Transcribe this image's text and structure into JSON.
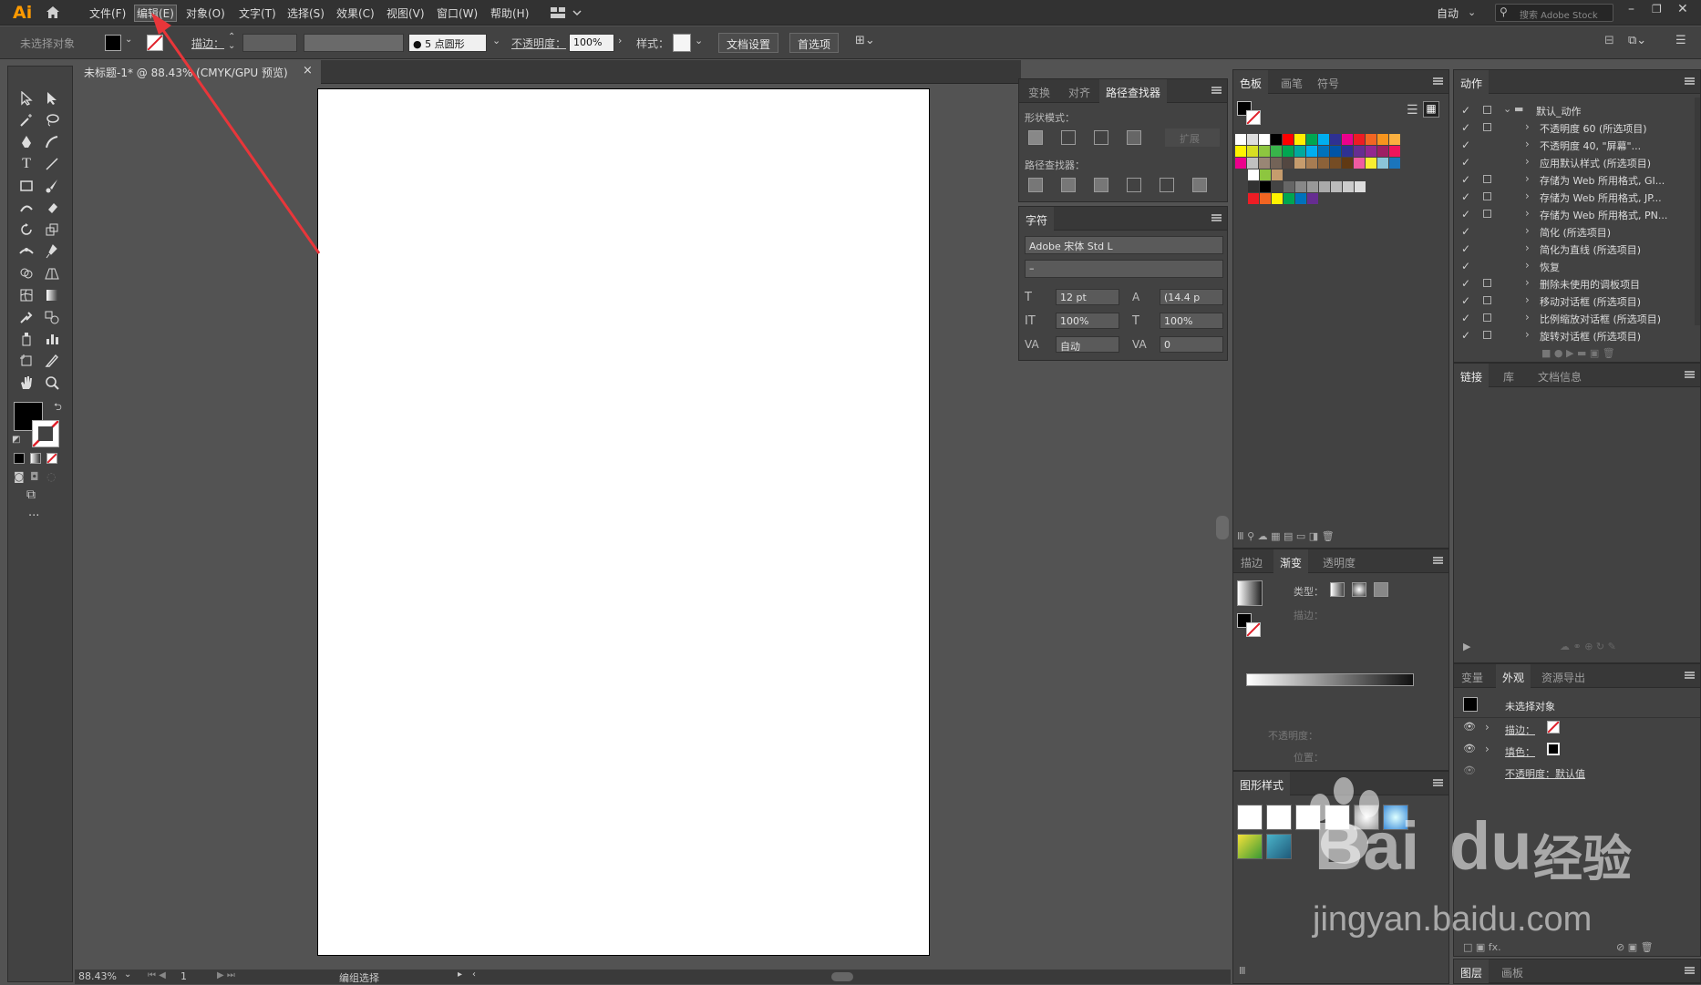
{
  "app": {
    "logo": "Ai"
  },
  "menu": [
    "文件(F)",
    "编辑(E)",
    "对象(O)",
    "文字(T)",
    "选择(S)",
    "效果(C)",
    "视图(V)",
    "窗口(W)",
    "帮助(H)"
  ],
  "window": {
    "workspace": "自动",
    "search_placeholder": "搜索 Adobe Stock"
  },
  "control": {
    "selection": "未选择对象",
    "stroke_label": "描边：",
    "brush": "5 点圆形",
    "opacity_label": "不透明度：",
    "opacity_value": "100%",
    "style_label": "样式：",
    "doc_setup": "文档设置",
    "prefs": "首选项"
  },
  "doc_tab": {
    "title": "未标题-1* @ 88.43% (CMYK/GPU 预览)",
    "close": "×"
  },
  "status": {
    "zoom": "88.43%",
    "page": "1",
    "tool": "编组选择"
  },
  "pathfinder": {
    "tabs": [
      "变换",
      "对齐",
      "路径查找器"
    ],
    "shape_modes": "形状模式：",
    "expand": "扩展",
    "pathfinders": "路径查找器："
  },
  "character": {
    "title": "字符",
    "font": "Adobe 宋体 Std L",
    "style": "–",
    "size": "12 pt",
    "leading": "(14.4 p",
    "v_scale": "100%",
    "h_scale": "100%",
    "kerning": "自动",
    "tracking": "0"
  },
  "swatches": {
    "tabs": [
      "色板",
      "画笔",
      "符号"
    ]
  },
  "gradient": {
    "tabs": [
      "描边",
      "渐变",
      "透明度"
    ],
    "type_label": "类型：",
    "stroke_label": "描边：",
    "opacity_label": "不透明度：",
    "position_label": "位置："
  },
  "graphic_styles": {
    "title": "图形样式"
  },
  "actions": {
    "tab": "动作",
    "set": "默认_动作",
    "items": [
      "不透明度 60 (所选项目)",
      "不透明度 40, \"屏幕\"...",
      "应用默认样式 (所选项目)",
      "存储为 Web 所用格式, GI...",
      "存储为 Web 所用格式, JP...",
      "存储为 Web 所用格式, PN...",
      "简化 (所选项目)",
      "简化为直线 (所选项目)",
      "恢复",
      "删除未使用的调板项目",
      "移动对话框 (所选项目)",
      "比例缩放对话框 (所选项目)",
      "旋转对话框 (所选项目)"
    ]
  },
  "links": {
    "tabs": [
      "链接",
      "库",
      "文档信息"
    ]
  },
  "appearance": {
    "tabs": [
      "变量",
      "外观",
      "资源导出"
    ],
    "header": "未选择对象",
    "stroke": "描边：",
    "fill": "填色：",
    "opacity": "不透明度：默认值"
  },
  "layers": {
    "tabs": [
      "图层",
      "画板"
    ]
  },
  "watermark": {
    "brand": "Bai",
    "brand2": "du",
    "cn": "经验",
    "url": "jingyan.baidu.com"
  },
  "colors": {
    "accent_arrow": "#e8363a",
    "ai_logo": "#ff9a00"
  }
}
